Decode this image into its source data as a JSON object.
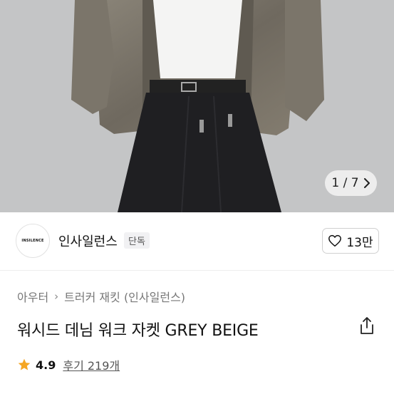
{
  "gallery": {
    "counter": "1 / 7"
  },
  "brand": {
    "logo_text": "INSILENCE",
    "name": "인사일런스",
    "badge": "단독",
    "likes": "13만"
  },
  "breadcrumb": {
    "category": "아우터",
    "subcategory": "트러커 재킷 (인사일런스)"
  },
  "product": {
    "title": "워시드 데님 워크 자켓 GREY BEIGE",
    "rating": "4.9",
    "reviews": "후기 219개"
  },
  "colors": {
    "star": "#f5a623",
    "accent": "#111111"
  },
  "icons": [
    "chevron-right-icon",
    "heart-icon",
    "share-icon",
    "star-icon"
  ]
}
